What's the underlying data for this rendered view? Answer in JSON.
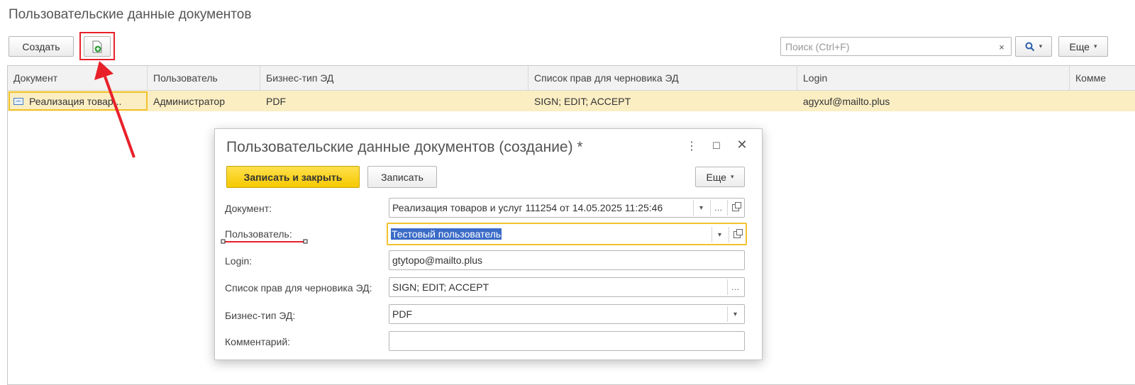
{
  "page": {
    "title": "Пользовательские данные документов"
  },
  "toolbar": {
    "create_label": "Создать",
    "add_icon": "document-add-icon",
    "search_placeholder": "Поиск (Ctrl+F)",
    "clear_symbol": "×",
    "search_icon": "search-icon",
    "more_label": "Еще"
  },
  "table": {
    "columns": [
      "Документ",
      "Пользователь",
      "Бизнес-тип ЭД",
      "Список прав для черновика ЭД",
      "Login",
      "Комме"
    ],
    "rows": [
      [
        "Реализация товар...",
        "Администратор",
        "PDF",
        "SIGN; EDIT; ACCEPT",
        "agyxuf@mailto.plus",
        ""
      ]
    ]
  },
  "dialog": {
    "title": "Пользовательские данные документов (создание) *",
    "save_close_label": "Записать и закрыть",
    "save_label": "Записать",
    "more_label": "Еще",
    "fields": {
      "document": {
        "label": "Документ:",
        "value": "Реализация товаров и услуг 111254 от 14.05.2025 11:25:46"
      },
      "user": {
        "label": "Пользователь:",
        "value": "Тестовый пользователь"
      },
      "login": {
        "label": "Login:",
        "value": "gtytopo@mailto.plus"
      },
      "rights": {
        "label": "Список прав для черновика ЭД:",
        "value": "SIGN; EDIT; ACCEPT"
      },
      "biztype": {
        "label": "Бизнес-тип ЭД:",
        "value": "PDF"
      },
      "comment": {
        "label": "Комментарий:",
        "value": ""
      }
    }
  },
  "colors": {
    "accent_yellow": "#f6c900",
    "row_highlight": "#fbeec3",
    "annotation_red": "#e8202a",
    "selection_blue": "#3a6bc7"
  }
}
